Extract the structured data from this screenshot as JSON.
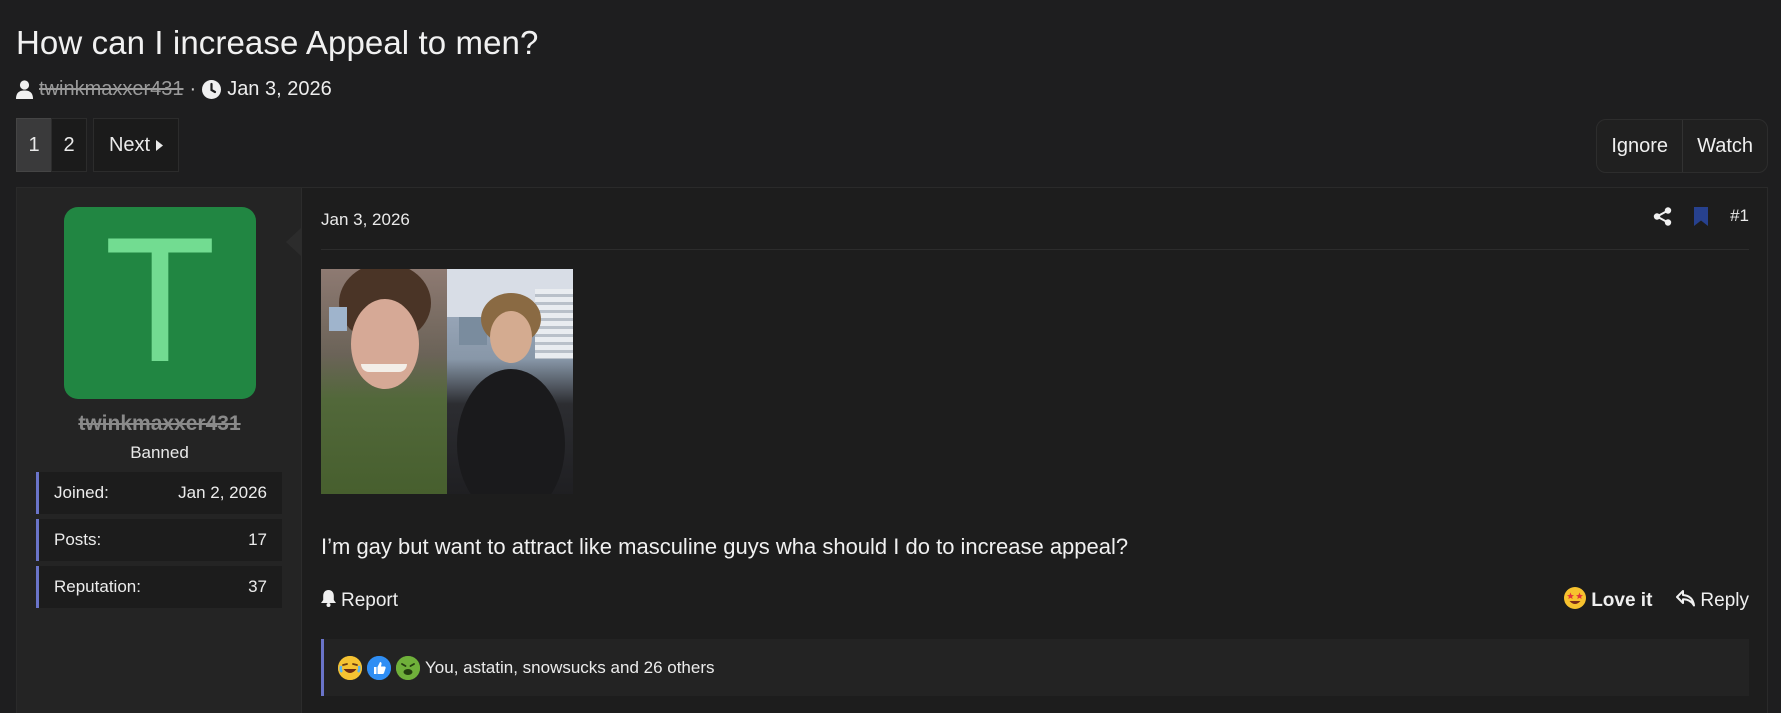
{
  "thread": {
    "title": "How can I increase Appeal to men?",
    "author": "twinkmaxxer431",
    "separator": "·",
    "date": "Jan 3, 2026"
  },
  "pagination": {
    "current": "1",
    "pages": [
      "2"
    ],
    "next_label": "Next"
  },
  "thread_actions": {
    "ignore_label": "Ignore",
    "watch_label": "Watch"
  },
  "user": {
    "avatar_letter": "T",
    "username": "twinkmaxxer431",
    "title": "Banned",
    "stats": [
      {
        "label": "Joined:",
        "value": "Jan 2, 2026"
      },
      {
        "label": "Posts:",
        "value": "17"
      },
      {
        "label": "Reputation:",
        "value": "37"
      }
    ]
  },
  "post": {
    "date": "Jan 3, 2026",
    "number": "#1",
    "text": "I’m gay but want to attract like masculine guys wha should I do to increase appeal?",
    "report_label": "Report",
    "love_label": "Love it",
    "reply_label": "Reply"
  },
  "reactions": {
    "icons": [
      "laughing-emoji",
      "thumbs-up-emoji",
      "sick-emoji"
    ],
    "summary": "You, astatin, snowsucks and 26 others"
  },
  "colors": {
    "background": "#1e1e1f",
    "avatar_bg": "#218642",
    "avatar_letter": "#72dc91",
    "accent_bar": "#6a74c9",
    "bookmark": "#27418e"
  }
}
